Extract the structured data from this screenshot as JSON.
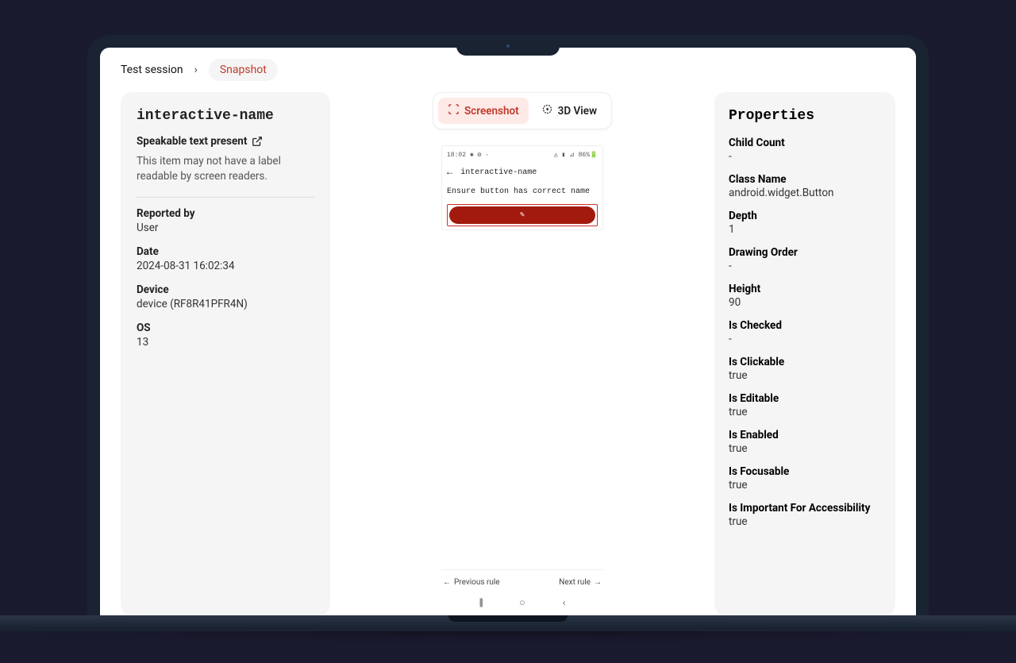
{
  "breadcrumb": {
    "test_session": "Test session",
    "current": "Snapshot"
  },
  "left": {
    "title": "interactive-name",
    "subhead": "Speakable text present",
    "description": "This item may not have a label readable by screen readers.",
    "fields": {
      "reported_by": {
        "label": "Reported by",
        "value": "User"
      },
      "date": {
        "label": "Date",
        "value": "2024-08-31 16:02:34"
      },
      "device": {
        "label": "Device",
        "value": "device (RF8R41PFR4N)"
      },
      "os": {
        "label": "OS",
        "value": "13"
      }
    }
  },
  "center": {
    "tabs": {
      "screenshot": "Screenshot",
      "three_d": "3D View"
    },
    "phone": {
      "time": "18:02",
      "status_icons": "✱ ⚙ ·",
      "signal_icons": "◬ ▮ ⊿ 86%🔋",
      "title": "interactive-name",
      "instruction": "Ensure button has correct name"
    },
    "pager": {
      "prev": "Previous rule",
      "next": "Next rule"
    }
  },
  "right": {
    "title": "Properties",
    "props": {
      "child_count": {
        "label": "Child Count",
        "value": "-"
      },
      "class_name": {
        "label": "Class Name",
        "value": "android.widget.Button"
      },
      "depth": {
        "label": "Depth",
        "value": "1"
      },
      "drawing_order": {
        "label": "Drawing Order",
        "value": "-"
      },
      "height": {
        "label": "Height",
        "value": "90"
      },
      "is_checked": {
        "label": "Is Checked",
        "value": "-"
      },
      "is_clickable": {
        "label": "Is Clickable",
        "value": "true"
      },
      "is_editable": {
        "label": "Is Editable",
        "value": "true"
      },
      "is_enabled": {
        "label": "Is Enabled",
        "value": "true"
      },
      "is_focusable": {
        "label": "Is Focusable",
        "value": "true"
      },
      "is_important": {
        "label": "Is Important For Accessibility",
        "value": "true"
      }
    }
  }
}
